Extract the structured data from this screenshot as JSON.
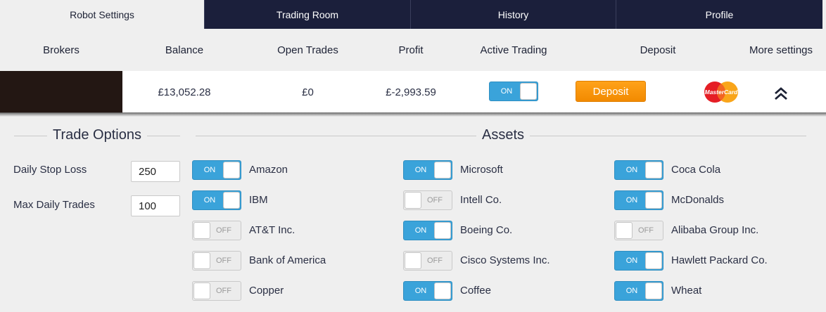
{
  "tabs": [
    {
      "label": "Robot Settings",
      "active": true
    },
    {
      "label": "Trading Room",
      "active": false
    },
    {
      "label": "History",
      "active": false
    },
    {
      "label": "Profile",
      "active": false
    }
  ],
  "header": {
    "brokers": "Brokers",
    "balance": "Balance",
    "open_trades": "Open Trades",
    "profit": "Profit",
    "active_trading": "Active Trading",
    "deposit": "Deposit",
    "more_settings": "More settings"
  },
  "account": {
    "balance": "£13,052.28",
    "open_trades": "£0",
    "profit": "£-2,993.59",
    "active_trading": {
      "label": "ON",
      "state": "on"
    },
    "deposit_button": "Deposit",
    "card_brand_text": "MasterCard"
  },
  "trade_options": {
    "title": "Trade Options",
    "daily_stop_loss_label": "Daily Stop Loss",
    "daily_stop_loss_value": "250",
    "max_daily_trades_label": "Max Daily Trades",
    "max_daily_trades_value": "100"
  },
  "assets": {
    "title": "Assets",
    "col1": [
      {
        "name": "Amazon",
        "toggle": "ON",
        "state": "on"
      },
      {
        "name": "IBM",
        "toggle": "ON",
        "state": "on"
      },
      {
        "name": "AT&T Inc.",
        "toggle": "OFF",
        "state": "off"
      },
      {
        "name": "Bank of America",
        "toggle": "OFF",
        "state": "off"
      },
      {
        "name": "Copper",
        "toggle": "OFF",
        "state": "off"
      }
    ],
    "col2": [
      {
        "name": "Microsoft",
        "toggle": "ON",
        "state": "on"
      },
      {
        "name": "Intell Co.",
        "toggle": "OFF",
        "state": "off"
      },
      {
        "name": "Boeing Co.",
        "toggle": "ON",
        "state": "on"
      },
      {
        "name": "Cisco Systems Inc.",
        "toggle": "OFF",
        "state": "off"
      },
      {
        "name": "Coffee",
        "toggle": "ON",
        "state": "on"
      }
    ],
    "col3": [
      {
        "name": "Coca Cola",
        "toggle": "ON",
        "state": "on"
      },
      {
        "name": "McDonalds",
        "toggle": "ON",
        "state": "on"
      },
      {
        "name": "Alibaba Group Inc.",
        "toggle": "OFF",
        "state": "off"
      },
      {
        "name": "Hawlett Packard Co.",
        "toggle": "ON",
        "state": "on"
      },
      {
        "name": "Wheat",
        "toggle": "ON",
        "state": "on"
      }
    ]
  },
  "colors": {
    "nav_dark": "#1b1f3b",
    "toggle_on": "#3aa3da",
    "deposit_orange": "#f7941d"
  },
  "icons": {
    "collapse": "chevron-double-up-icon",
    "card": "mastercard-logo"
  }
}
